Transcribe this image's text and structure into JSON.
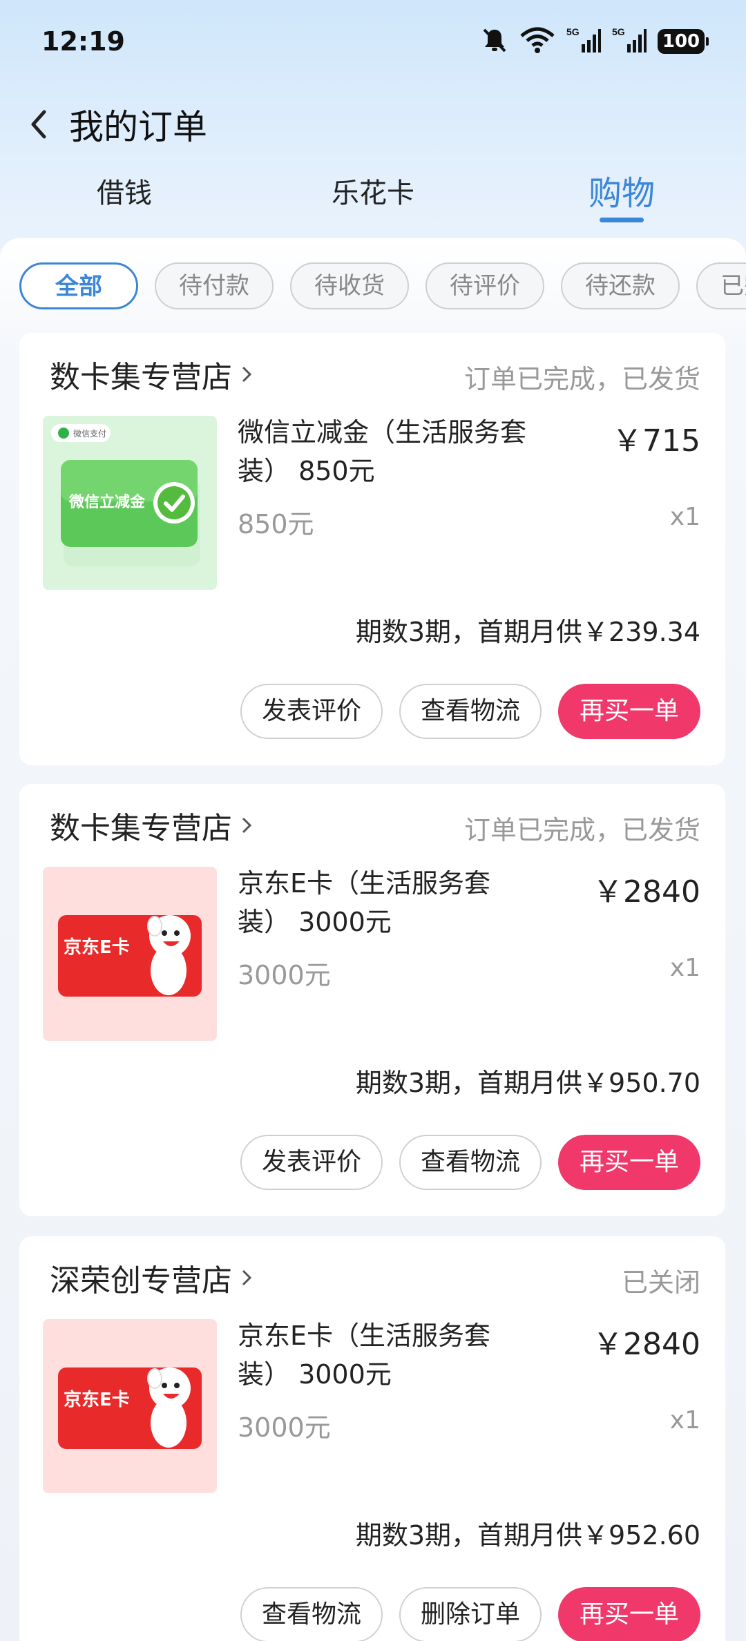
{
  "status_bar": {
    "time": "12:19",
    "battery": "100"
  },
  "header": {
    "title": "我的订单"
  },
  "tabs": [
    {
      "label": "借钱"
    },
    {
      "label": "乐花卡"
    },
    {
      "label": "购物",
      "active": true
    }
  ],
  "filters": [
    "全部",
    "待付款",
    "待收货",
    "待评价",
    "待还款",
    "已完成"
  ],
  "orders": [
    {
      "shop": "数卡集专营店",
      "status": "订单已完成，已发货",
      "product": "微信立减金（生活服务套装） 850元",
      "image_label": "微信立减金",
      "image_badge": "微信支付",
      "price": "￥715",
      "spec": "850元",
      "qty": "x1",
      "installment": "期数3期，首期月供￥239.34",
      "actions": [
        "发表评价",
        "查看物流",
        "再买一单"
      ]
    },
    {
      "shop": "数卡集专营店",
      "status": "订单已完成，已发货",
      "product": "京东E卡（生活服务套装） 3000元",
      "image_label": "京东E卡",
      "price": "￥2840",
      "spec": "3000元",
      "qty": "x1",
      "installment": "期数3期，首期月供￥950.70",
      "actions": [
        "发表评价",
        "查看物流",
        "再买一单"
      ]
    },
    {
      "shop": "深荣创专营店",
      "status": "已关闭",
      "product": "京东E卡（生活服务套装） 3000元",
      "image_label": "京东E卡",
      "price": "￥2840",
      "spec": "3000元",
      "qty": "x1",
      "installment": "期数3期，首期月供￥952.60",
      "actions": [
        "查看物流",
        "删除订单",
        "再买一单"
      ]
    }
  ],
  "colors": {
    "accent": "#3b86d9",
    "primary_button": "#f0386b",
    "muted_text": "#999999"
  }
}
